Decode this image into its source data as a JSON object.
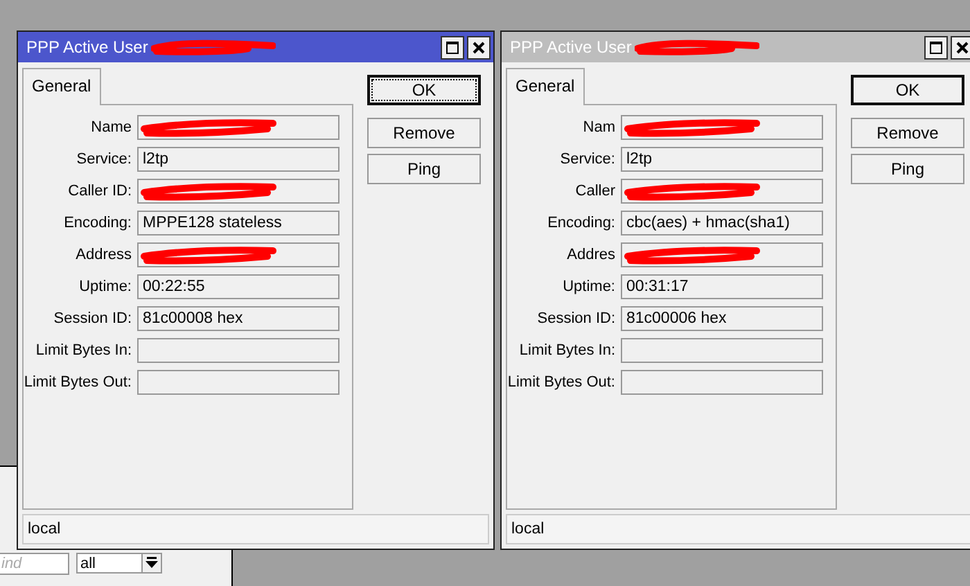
{
  "background_window": {
    "find_placeholder": "ind",
    "filter": "all"
  },
  "windows": [
    {
      "title": "PPP Active User",
      "active": true,
      "title_redacted": true,
      "tabs": [
        {
          "label": "General",
          "selected": true
        }
      ],
      "fields": [
        {
          "label": "Name",
          "redacted": true
        },
        {
          "label": "Service:",
          "value": "l2tp",
          "redacted": false
        },
        {
          "label": "Caller ID:",
          "redacted": true
        },
        {
          "label": "Encoding:",
          "value": "MPPE128 stateless",
          "redacted": false
        },
        {
          "label": "Address",
          "redacted": true
        },
        {
          "label": "Uptime:",
          "value": "00:22:55",
          "redacted": false
        },
        {
          "label": "Session ID:",
          "value": "81c00008 hex",
          "redacted": false
        },
        {
          "label": "Limit Bytes In:",
          "redacted": false
        },
        {
          "label": "Limit Bytes Out:",
          "redacted": false
        }
      ],
      "buttons": [
        {
          "label": "OK",
          "default": true,
          "focused": true
        },
        {
          "label": "Remove",
          "default": false,
          "focused": false
        },
        {
          "label": "Ping",
          "default": false,
          "focused": false
        }
      ],
      "status": "local"
    },
    {
      "title": "PPP Active User",
      "active": false,
      "title_redacted": true,
      "tabs": [
        {
          "label": "General",
          "selected": true
        }
      ],
      "fields": [
        {
          "label": "Nam",
          "redacted": true
        },
        {
          "label": "Service:",
          "value": "l2tp",
          "redacted": false
        },
        {
          "label": "Caller",
          "redacted": true
        },
        {
          "label": "Encoding:",
          "value": "cbc(aes) + hmac(sha1)",
          "redacted": false
        },
        {
          "label": "Addres",
          "redacted": true
        },
        {
          "label": "Uptime:",
          "value": "00:31:17",
          "redacted": false
        },
        {
          "label": "Session ID:",
          "value": "81c00006 hex",
          "redacted": false
        },
        {
          "label": "Limit Bytes In:",
          "redacted": false
        },
        {
          "label": "Limit Bytes Out:",
          "redacted": false
        }
      ],
      "buttons": [
        {
          "label": "OK",
          "default": true,
          "focused": false
        },
        {
          "label": "Remove",
          "default": false,
          "focused": false
        },
        {
          "label": "Ping",
          "default": false,
          "focused": false
        }
      ],
      "status": "local"
    }
  ]
}
